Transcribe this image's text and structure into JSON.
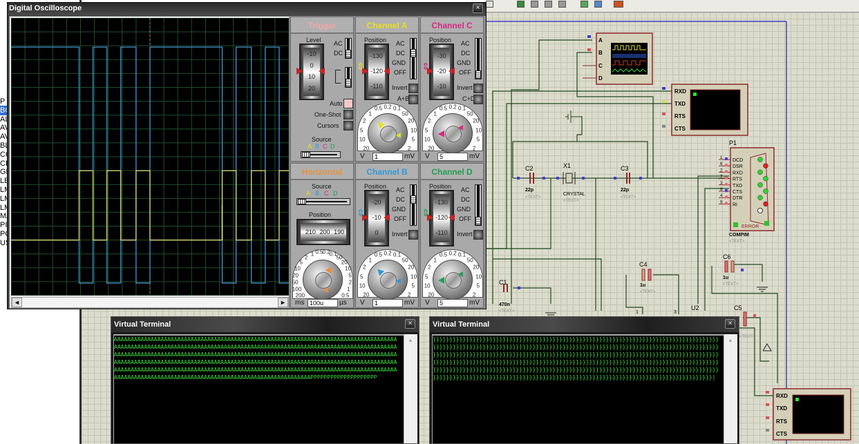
{
  "left_panel": {
    "items": [
      "P",
      "BC",
      "AL",
      "AV",
      "AV",
      "BL",
      "CO",
      "CR",
      "GE",
      "LE",
      "LM",
      "LM",
      "LM",
      "MA",
      "PI",
      "PO",
      "US"
    ],
    "selected_index": 1
  },
  "schematic": {
    "scope_pins": [
      "A",
      "B",
      "C",
      "D"
    ],
    "terminal_pins": [
      "RXD",
      "TXD",
      "RTS",
      "CTS"
    ],
    "p1": {
      "ref": "P1",
      "pins_num": [
        "1",
        "6",
        "2",
        "7",
        "3",
        "8",
        "4",
        "9"
      ],
      "pins": [
        "DCD",
        "DSR",
        "RXD",
        "RTS",
        "TXD",
        "CTS",
        "DTR",
        "RI"
      ],
      "error": "ERROR",
      "name": "COMPIM",
      "text": "<TEXT>"
    },
    "c2": {
      "ref": "C2",
      "value": "22p",
      "text": "<TEXT>"
    },
    "x1": {
      "ref": "X1",
      "value": "CRYSTAL",
      "text": "<TEXT>"
    },
    "c3": {
      "ref": "C3",
      "value": "22p",
      "text": "<TEXT>"
    },
    "c1": {
      "ref": "C1",
      "value": "470n",
      "text": "<TEXT>"
    },
    "c4": {
      "ref": "C4",
      "value": "1u",
      "text": "<TEXT>"
    },
    "c6": {
      "ref": "C6",
      "value": "1u",
      "text": "<TEXT>"
    },
    "c5": {
      "ref": "C5",
      "text": "<TEXT>"
    },
    "u2": {
      "ref": "U2",
      "pin1": "1",
      "pin3": "3"
    },
    "colors": {
      "wire": "#1f4a1f",
      "border": "#2020c0",
      "component": "#8b2a2a"
    }
  },
  "oscilloscope": {
    "title": "Digital Oscilloscope",
    "close": "×",
    "scroll_left": "◄",
    "scroll_right": "►",
    "trigger": {
      "title": "Trigger",
      "level_label": "Level",
      "drum": [
        "-10",
        "0",
        "10",
        "20"
      ],
      "ac": "AC",
      "dc": "DC",
      "auto": "Auto",
      "one_shot": "One-Shot",
      "cursors": "Cursors",
      "source_label": "Source",
      "sources": [
        "A",
        "B",
        "C",
        "D"
      ],
      "color": "#f0a8a8"
    },
    "horizontal": {
      "title": "Horizontal",
      "source_label": "Source",
      "sources": [
        "A",
        "B",
        "C",
        "D"
      ],
      "position_label": "Position",
      "drum": [
        "210",
        "200",
        "190"
      ],
      "dial_labels": [
        "200",
        "100",
        "50",
        "20",
        "10",
        "5",
        "2",
        "1",
        "0.5",
        "0.2",
        "0.1",
        "50",
        "20",
        "10",
        "5",
        "2",
        "1",
        "0.5"
      ],
      "unit_left": "ms",
      "unit_right": "µs",
      "value": "100u",
      "color": "#e89040"
    },
    "channels": [
      {
        "title": "Channel A",
        "color": "#e8e020",
        "position_label": "Position",
        "drum": [
          "-130",
          "-120",
          "-110"
        ],
        "coupling": [
          "AC",
          "DC",
          "GND",
          "OFF"
        ],
        "coupling_selected": "DC",
        "invert": "Invert",
        "combine": "A+B",
        "dial_labels": [
          "20",
          "10",
          "5",
          "2",
          "1",
          "0.5",
          "0.2",
          "0.1",
          "50",
          "20",
          "10",
          "5",
          "2"
        ],
        "unit_left": "V",
        "unit_right": "mV",
        "value": "1"
      },
      {
        "title": "Channel C",
        "color": "#d82888",
        "position_label": "Position",
        "drum": [
          "-30",
          "-20",
          "-10"
        ],
        "coupling": [
          "AC",
          "DC",
          "GND",
          "OFF"
        ],
        "coupling_selected": "OFF",
        "invert": "Invert",
        "combine": "C+D",
        "dial_labels": [
          "20",
          "10",
          "5",
          "2",
          "1",
          "0.5",
          "0.2",
          "0.1",
          "50",
          "20",
          "10",
          "5",
          "2"
        ],
        "unit_left": "V",
        "unit_right": "mV",
        "value": "5"
      },
      {
        "title": "Channel B",
        "color": "#3098d8",
        "position_label": "Position",
        "drum": [
          "-20",
          "-10",
          "0"
        ],
        "coupling": [
          "AC",
          "DC",
          "GND",
          "OFF"
        ],
        "coupling_selected": "DC",
        "invert": "Invert",
        "dial_labels": [
          "20",
          "10",
          "5",
          "2",
          "1",
          "0.5",
          "0.2",
          "0.1",
          "50",
          "20",
          "10",
          "5",
          "2"
        ],
        "unit_left": "V",
        "unit_right": "mV",
        "value": "1"
      },
      {
        "title": "Channel D",
        "color": "#20a050",
        "position_label": "Position",
        "drum": [
          "-130",
          "-120",
          "-110"
        ],
        "coupling": [
          "AC",
          "DC",
          "GND",
          "OFF"
        ],
        "coupling_selected": "OFF",
        "invert": "Invert",
        "dial_labels": [
          "20",
          "10",
          "5",
          "2",
          "1",
          "0.5",
          "0.2",
          "0.1",
          "50",
          "20",
          "10",
          "5",
          "2"
        ],
        "unit_left": "V",
        "unit_right": "mV",
        "value": "5"
      }
    ]
  },
  "chart_data": {
    "type": "line",
    "grid": true,
    "x_divisions": 20,
    "y_divisions": 20,
    "x_unit": "divisions",
    "y_unit": "divisions",
    "xlim": [
      0,
      20
    ],
    "ylim": [
      -10,
      10
    ],
    "trigger_marker_div": 10,
    "series": [
      {
        "channel": "B",
        "color": "#4aa0e0",
        "start": "high",
        "high": 7.9,
        "low": -9.1,
        "edges": [
          4.9,
          5.9,
          6.9,
          7.9,
          9.0,
          10.0,
          15.2,
          16.2,
          17.3,
          18.3,
          19.3
        ]
      },
      {
        "channel": "A",
        "color": "#e8e880",
        "start": "low",
        "high": -1.0,
        "low": -6.0,
        "edges": [
          4.9,
          5.9,
          6.9,
          7.9,
          9.0,
          10.0,
          15.2,
          16.2,
          17.3,
          18.3,
          19.3
        ],
        "spike": {
          "at": 15.2,
          "level": -3.5
        }
      }
    ]
  },
  "terminals": [
    {
      "title": "Virtual Terminal",
      "close": "×",
      "scroll_up": "▲",
      "lines": [
        "AAAAAAAAAAAAAAAAAAAAAAAAAAAAAAAAAAAAAAAAAAAAAAAAAAAAAAAAAAAAAAAAAAAAAAAAAAAAAAAAAAAAA",
        "AAAAAAAAAAAAAAAAAAAAAAAAAAAAAAAAAAAAAAAAAAAAAAAAAAAAAAAAAAAAAAAAAAAAAAAAAAAAAAAAAAAAA",
        "AAAAAAAAAAAAAAAAAAAAAAAAAAAAAAAAAAAAAAAAAAAAAAAAAAAAAAAAAAAAAAAAAAAAAAAAAAAAAAAAAAAAA",
        "AAAAAAAAAAAAAAAAAAAAAAAAAAAAAAAAAAAAAAAAAAAAAAAAAAAAAAAAAAAAAAAAAAAAAAAAAAAAAAAAAAAAA",
        "AAAAAAAAAAAAAAAAAAAAAAAAAAAAAAAAAAAAAAAAAAAAAAAAAAAAAAAAAAAAAAAAAAAAAAAAAAAAAAAAAAAAA",
        "AAAAAAAAAAAAAAAAAAAAAAAAAAAAAAAAAAAAAAAAAAAAAAAAAAAAAAAAAAAPPPPPPPPPPPPPPPPPPPP"
      ]
    },
    {
      "title": "Virtual Terminal",
      "close": "×",
      "scroll_up": "▲",
      "lines": [
        "}}}}}}}}}}}}}}}}}}}}}}}}}}}}}}}}}}}}}}}}}}}}}}}}}}}}}}}}}}}}}}}}}}}}}}}}}}}}}}}}}}}}}}",
        "}}}}}}}}}}}}}}}}}}}}}}}}}}}}}}}}}}}}}}}}}}}}}}}}}}}}}}}}}}}}}}}}}}}}}}}}}}}}}}}}}}}}}}",
        "}}}}}}}}}}}}}}}}}}}}}}}}}}}}}}}}}}}}}}}}}}}}}}}}}}}}}}}}}}}}}}}}}}}}}}}}}}}}}}}}}}}}}}",
        "}}}}}}}}}}}}}}}}}}}}}}}}}}}}}}}}}}}}}}}}}}}}}}}}}}}}}}}}}}}}}}}}}}}}}}}}}}}}}}}}}}}}}}",
        "}}}}}}}}}}}}}}}}}}}}}}}}}}}}}}}}}}}}}}}}}}}}}}}}}}}}}}}}}}}}}}}}}}}}}}}}}}}}}}}}}}}}}}",
        "}}}}}}}}}}}}}}}}}}}}}}}}}}}}}}}}}}}}}}}}}}}}}}}}}}}}}}}}}}}}}}}}}}}}}}}}}}}}}}}}}}}}|"
      ]
    }
  ]
}
